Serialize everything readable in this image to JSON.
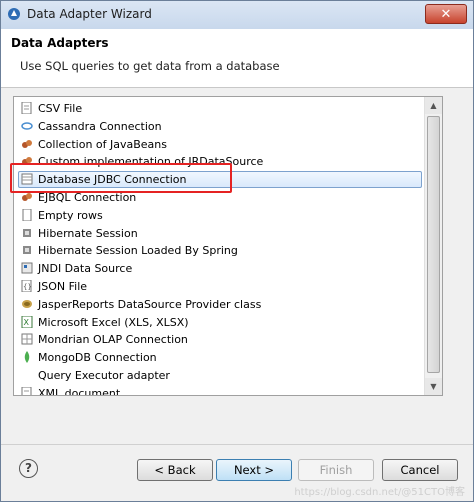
{
  "window": {
    "title": "Data Adapter Wizard"
  },
  "header": {
    "title": "Data Adapters",
    "description": "Use SQL queries to get data from a database"
  },
  "adapters": [
    {
      "label": "CSV File",
      "icon": "csv-file-icon"
    },
    {
      "label": "Cassandra Connection",
      "icon": "cassandra-icon"
    },
    {
      "label": "Collection of JavaBeans",
      "icon": "javabeans-icon"
    },
    {
      "label": "Custom implementation of JRDataSource",
      "icon": "custom-datasource-icon"
    },
    {
      "label": "Database JDBC Connection",
      "icon": "database-icon",
      "selected": true
    },
    {
      "label": "EJBQL Connection",
      "icon": "ejbql-icon"
    },
    {
      "label": "Empty rows",
      "icon": "empty-rows-icon"
    },
    {
      "label": "Hibernate Session",
      "icon": "hibernate-icon"
    },
    {
      "label": "Hibernate Session Loaded By Spring",
      "icon": "hibernate-spring-icon"
    },
    {
      "label": "JNDI Data Source",
      "icon": "jndi-icon"
    },
    {
      "label": "JSON File",
      "icon": "json-icon"
    },
    {
      "label": "JasperReports DataSource Provider class",
      "icon": "jasper-icon"
    },
    {
      "label": "Microsoft Excel (XLS, XLSX)",
      "icon": "excel-icon"
    },
    {
      "label": "Mondrian OLAP Connection",
      "icon": "mondrian-icon"
    },
    {
      "label": "MongoDB Connection",
      "icon": "mongodb-icon"
    },
    {
      "label": "Query Executor adapter",
      "icon": ""
    },
    {
      "label": "XML document",
      "icon": "xml-icon"
    }
  ],
  "buttons": {
    "back": "< Back",
    "next": "Next >",
    "finish": "Finish",
    "cancel": "Cancel"
  },
  "watermark": "https://blog.csdn.net/@51CTO博客"
}
